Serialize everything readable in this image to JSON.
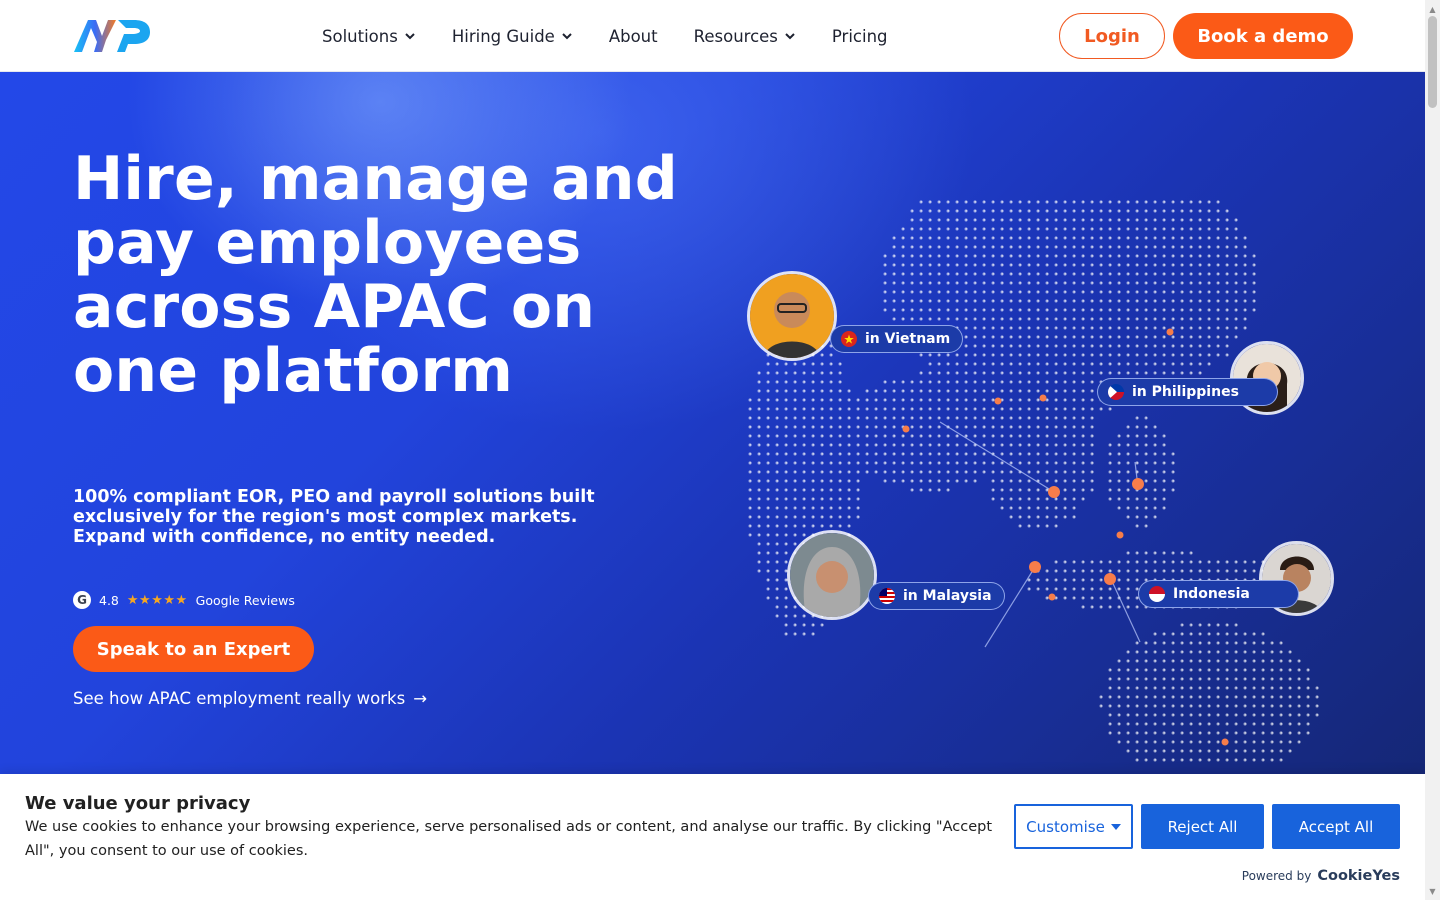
{
  "header": {
    "nav": [
      {
        "label": "Solutions",
        "has_dropdown": true
      },
      {
        "label": "Hiring Guide",
        "has_dropdown": true
      },
      {
        "label": "About",
        "has_dropdown": false
      },
      {
        "label": "Resources",
        "has_dropdown": true
      },
      {
        "label": "Pricing",
        "has_dropdown": false
      }
    ],
    "login_label": "Login",
    "demo_label": "Book a demo"
  },
  "hero": {
    "title": "Hire, manage and pay employees across APAC on one platform",
    "subtitle": "100% compliant EOR, PEO and payroll solutions built exclusively for the region's most complex markets. Expand with confidence, no entity needed.",
    "rating": "4.8",
    "stars": "★★★★★",
    "reviews_label": "Google Reviews",
    "google_letter": "G",
    "cta_label": "Speak to an Expert",
    "link_label": "See how APAC employment really works",
    "link_arrow": "→",
    "locations": [
      {
        "label": "in Vietnam"
      },
      {
        "label": "in Philippines"
      },
      {
        "label": "in Malaysia"
      },
      {
        "label": "Indonesia"
      }
    ]
  },
  "cookie": {
    "title": "We value your privacy",
    "text": "We use cookies to enhance your browsing experience, serve personalised ads or content, and analyse our traffic. By clicking \"Accept All\", you consent to our use of cookies.",
    "customise_label": "Customise",
    "reject_label": "Reject All",
    "accept_label": "Accept All",
    "powered_label": "Powered by",
    "powered_brand": "CookieYes"
  },
  "colors": {
    "accent_orange": "#fb5a17",
    "hero_blue": "#2348e8",
    "cookie_blue": "#1863dc"
  }
}
